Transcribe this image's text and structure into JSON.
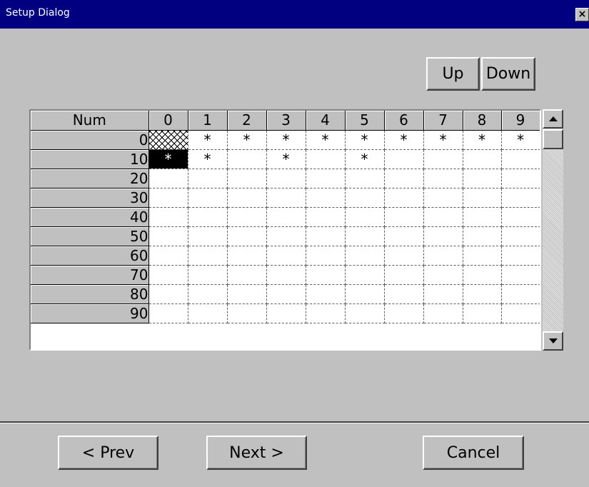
{
  "window": {
    "title": "Setup Dialog",
    "close_label": "×"
  },
  "toolbar": {
    "up_label": "Up",
    "down_label": "Down"
  },
  "grid": {
    "corner_label": "Num",
    "columns": [
      "0",
      "1",
      "2",
      "3",
      "4",
      "5",
      "6",
      "7",
      "8",
      "9"
    ],
    "rows": [
      {
        "label": "0",
        "cells": [
          "",
          "*",
          "*",
          "*",
          "*",
          "*",
          "*",
          "*",
          "*",
          "*"
        ]
      },
      {
        "label": "10",
        "cells": [
          "*",
          "*",
          "",
          "*",
          "",
          "*",
          "",
          "",
          "",
          ""
        ]
      },
      {
        "label": "20",
        "cells": [
          "",
          "",
          "",
          "",
          "",
          "",
          "",
          "",
          "",
          ""
        ]
      },
      {
        "label": "30",
        "cells": [
          "",
          "",
          "",
          "",
          "",
          "",
          "",
          "",
          "",
          ""
        ]
      },
      {
        "label": "40",
        "cells": [
          "",
          "",
          "",
          "",
          "",
          "",
          "",
          "",
          "",
          ""
        ]
      },
      {
        "label": "50",
        "cells": [
          "",
          "",
          "",
          "",
          "",
          "",
          "",
          "",
          "",
          ""
        ]
      },
      {
        "label": "60",
        "cells": [
          "",
          "",
          "",
          "",
          "",
          "",
          "",
          "",
          "",
          ""
        ]
      },
      {
        "label": "70",
        "cells": [
          "",
          "",
          "",
          "",
          "",
          "",
          "",
          "",
          "",
          ""
        ]
      },
      {
        "label": "80",
        "cells": [
          "",
          "",
          "",
          "",
          "",
          "",
          "",
          "",
          "",
          ""
        ]
      },
      {
        "label": "90",
        "cells": [
          "",
          "",
          "",
          "",
          "",
          "",
          "",
          "",
          "",
          ""
        ]
      }
    ]
  },
  "footer": {
    "prev_label": "< Prev",
    "next_label": "Next >",
    "cancel_label": "Cancel"
  }
}
